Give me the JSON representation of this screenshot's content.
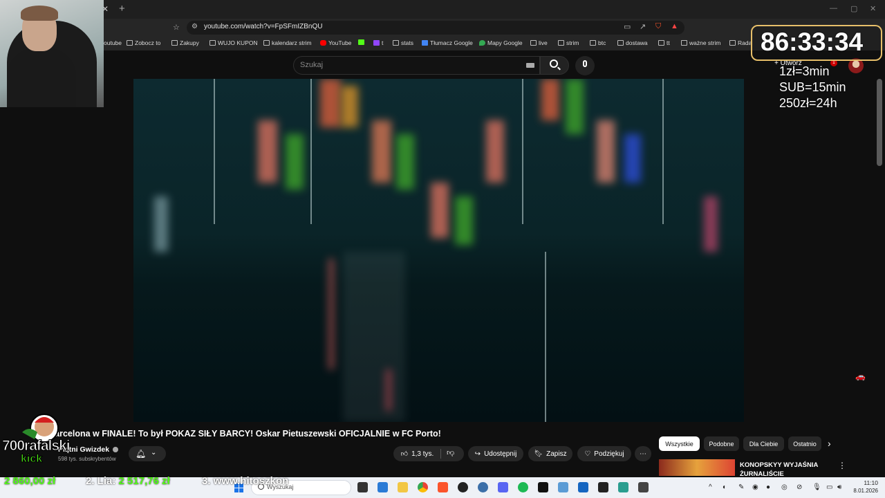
{
  "browser": {
    "url": "youtube.com/watch?v=FpSFmIZBnQU",
    "bookmarks": [
      {
        "label": "outube",
        "icon": "folder-icon"
      },
      {
        "label": "Zobocz to",
        "icon": "folder-icon"
      },
      {
        "label": "Zakupy",
        "icon": "folder-icon"
      },
      {
        "label": "WUJO KUPON",
        "icon": "folder-icon"
      },
      {
        "label": "kalendarz strim",
        "icon": "folder-icon"
      },
      {
        "label": "YouTube",
        "icon": "youtube-icon"
      },
      {
        "label": "",
        "icon": "kick-icon"
      },
      {
        "label": "t",
        "icon": "twitch-icon"
      },
      {
        "label": "stats",
        "icon": "stats-icon"
      },
      {
        "label": "Tłumacz Google",
        "icon": "translate-icon"
      },
      {
        "label": "Mapy Google",
        "icon": "maps-icon"
      },
      {
        "label": "live",
        "icon": "folder-icon"
      },
      {
        "label": "strim",
        "icon": "folder-icon"
      },
      {
        "label": "btc",
        "icon": "folder-icon"
      },
      {
        "label": "dostawa",
        "icon": "folder-icon"
      },
      {
        "label": "tt",
        "icon": "folder-icon"
      },
      {
        "label": "ważne strim",
        "icon": "folder-icon"
      },
      {
        "label": "Rada",
        "icon": "folder-icon"
      }
    ]
  },
  "youtube": {
    "search_placeholder": "Szukaj",
    "create_label": "Utwórz",
    "bell_count": "1",
    "video_title": "FC Barcelona w FINALE! To był POKAZ SIŁY BARCY! Oskar Pietuszewski OFICJALNIE w FC Porto!",
    "channel_name": "Piątni Gwizdek",
    "subscribers": "598 tys. subskrybentów",
    "likes": "1,3 tys.",
    "share_label": "Udostępnij",
    "save_label": "Zapisz",
    "thanks_label": "Podziękuj",
    "chips": [
      "Wszystkie",
      "Podobne",
      "Dla Ciebie",
      "Ostatnio"
    ],
    "recommended": {
      "title_line1": "KONOPSKYY WYJAŚNIA",
      "title_line2": "ŻURNALIŚCIE"
    }
  },
  "overlay": {
    "timer": "86:33:34",
    "rates": [
      "1zł=3min",
      "SUB=15min",
      "250zł=24h"
    ],
    "kick_name": "700rafalski",
    "kick_word": "kick",
    "ticker": [
      {
        "prefix": "",
        "value": "2 860,00 zł"
      },
      {
        "prefix": "2. Lia:",
        "value": "2 517,76 zł"
      },
      {
        "prefix": "3. www.hitoszkon",
        "value": ""
      }
    ]
  },
  "taskbar": {
    "search_placeholder": "Wyszukaj",
    "time": "11:10",
    "date": "8.01.2026"
  },
  "colors": {
    "accent_kick": "#53fc18",
    "youtube_red": "#ff0000",
    "timer_border": "#e8c06a"
  }
}
